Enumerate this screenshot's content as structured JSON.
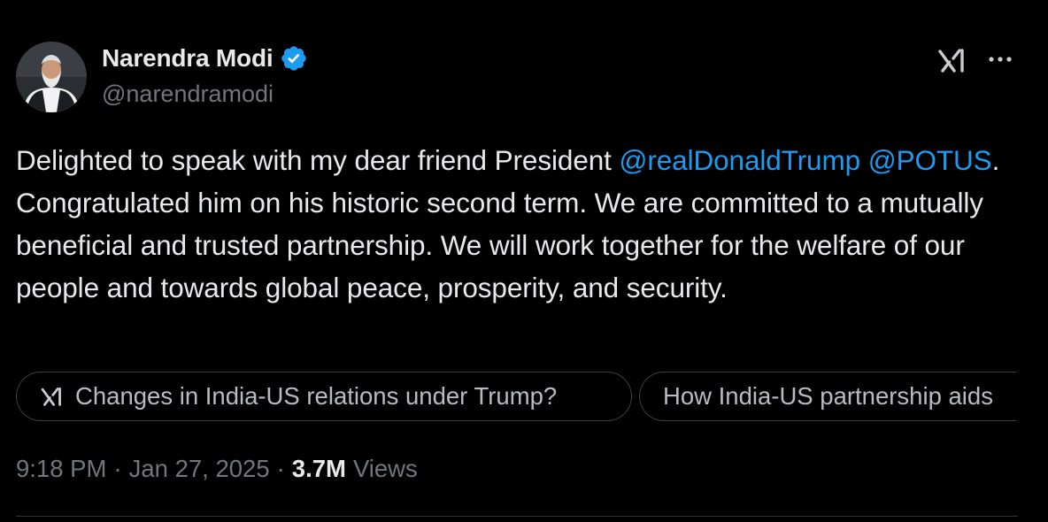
{
  "author": {
    "display_name": "Narendra Modi",
    "handle": "@narendramodi",
    "verified": true,
    "verified_color": "#1d9bf0"
  },
  "header_icons": {
    "grok": "grok-icon",
    "more": "more-icon"
  },
  "tweet": {
    "text_parts": {
      "p1": "Delighted to speak with my dear friend President ",
      "mention1": "@realDonaldTrump",
      "p2": " ",
      "mention2": "@POTUS",
      "p3": ". Congratulated him on his historic second term. We are committed to a mutually beneficial and trusted partnership. We will work together for the welfare of our people and towards global peace, prosperity, and security."
    },
    "mention_color": "#1d9bf0"
  },
  "suggestions": [
    {
      "label": "Changes in India-US relations under Trump?",
      "icon": "grok-icon"
    },
    {
      "label": "How India-US partnership aids"
    }
  ],
  "meta": {
    "time": "9:18 PM",
    "separator": "·",
    "date": "Jan 27, 2025",
    "views_count": "3.7M",
    "views_label": "Views"
  },
  "colors": {
    "background": "#000000",
    "text": "#e7e9ea",
    "secondary": "#71767b",
    "accent": "#1d9bf0"
  }
}
